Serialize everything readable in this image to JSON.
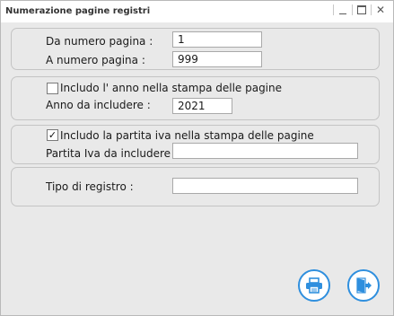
{
  "window": {
    "title": "Numerazione pagine registri",
    "controls": {
      "minimize": "minimize",
      "maximize": "maximize",
      "close": "✕"
    }
  },
  "pages": {
    "from_label": "Da numero pagina :",
    "from_value": "1",
    "to_label": "A numero pagina :",
    "to_value": "999"
  },
  "year": {
    "checkbox_label": "Includo l' anno nella stampa delle pagine",
    "checked": false,
    "year_label": "Anno da includere :",
    "year_value": "2021"
  },
  "vat": {
    "checkbox_label": "Includo la partita iva nella stampa delle pagine",
    "checked": true,
    "vat_label": "Partita Iva da includere :",
    "vat_value": ""
  },
  "register": {
    "type_label": "Tipo di registro :",
    "type_value": ""
  },
  "actions": {
    "print_icon": "printer-icon",
    "exit_icon": "exit-door-icon",
    "accent_color": "#2f8fde"
  }
}
